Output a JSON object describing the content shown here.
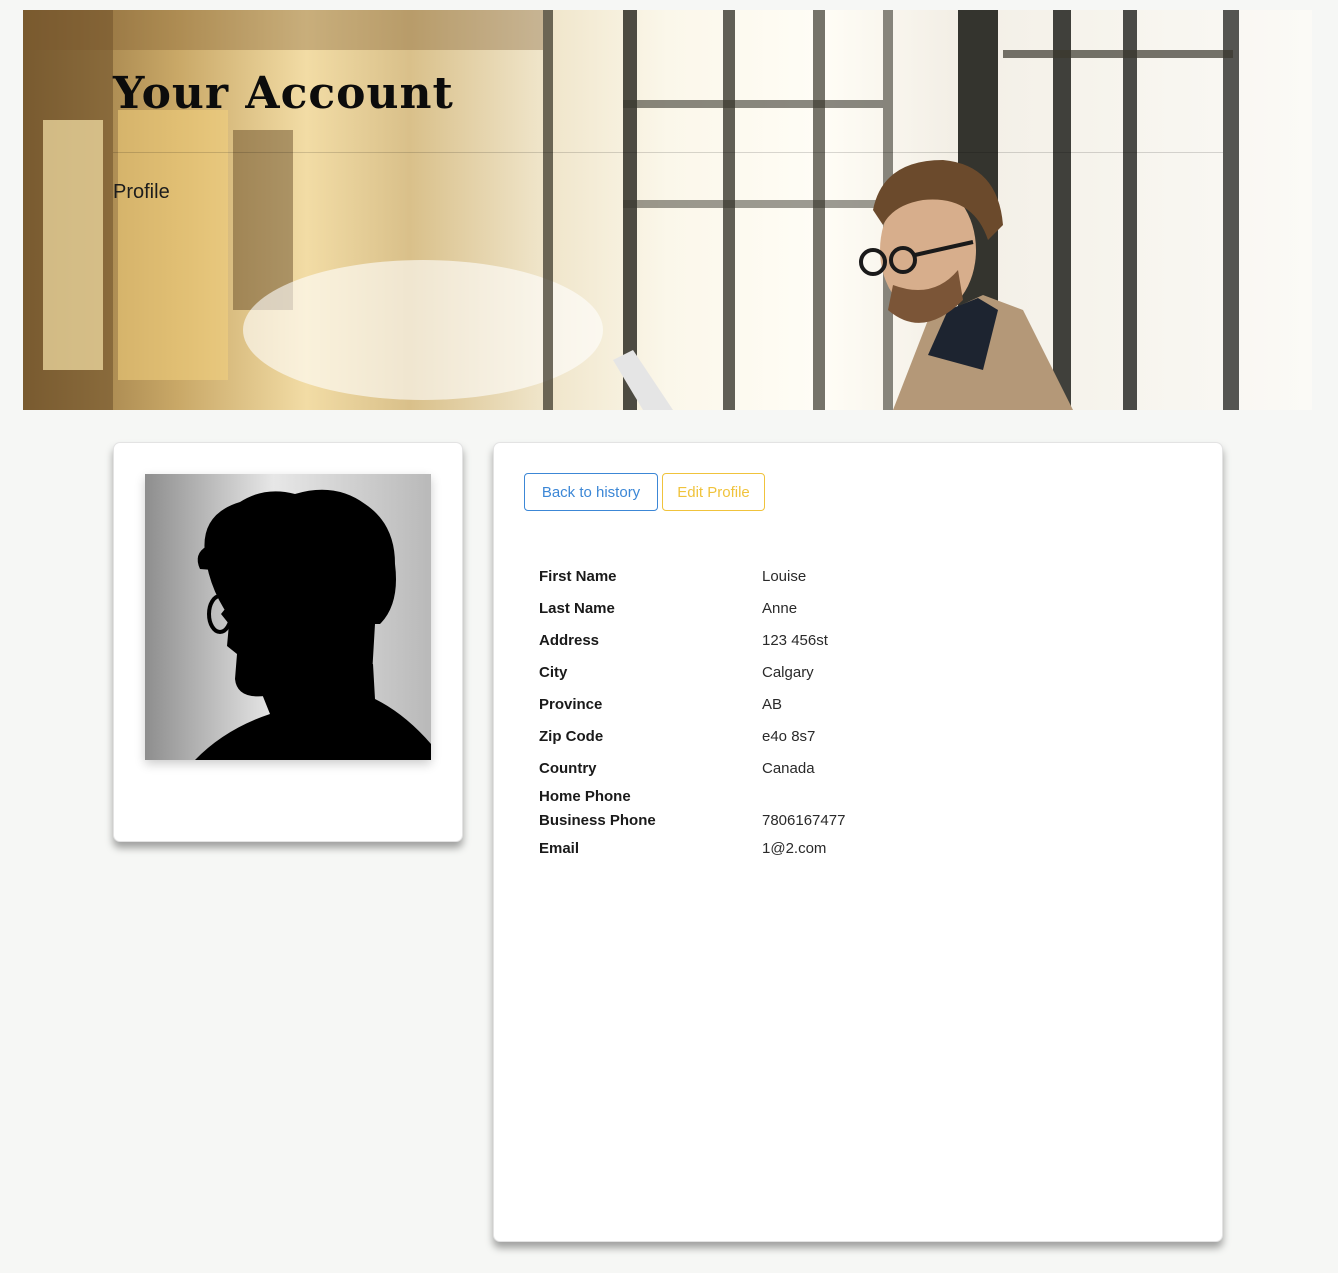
{
  "header": {
    "title": "Your Account",
    "subtitle": "Profile",
    "banner_image": "man-with-glasses-by-window-photo"
  },
  "avatar": {
    "image": "silhouette-profile-photo"
  },
  "actions": {
    "back_label": "Back to history",
    "edit_label": "Edit Profile"
  },
  "profile": {
    "fields": [
      {
        "label": "First Name",
        "value": "Louise"
      },
      {
        "label": "Last Name",
        "value": "Anne"
      },
      {
        "label": "Address",
        "value": "123 456st"
      },
      {
        "label": "City",
        "value": "Calgary"
      },
      {
        "label": "Province",
        "value": "AB"
      },
      {
        "label": "Zip Code",
        "value": "e4o 8s7"
      },
      {
        "label": "Country",
        "value": "Canada"
      },
      {
        "label": "Home Phone",
        "value": ""
      },
      {
        "label": "Business Phone",
        "value": "7806167477"
      },
      {
        "label": "Email",
        "value": "1@2.com"
      }
    ]
  },
  "colors": {
    "primary_outline": "#3c87d6",
    "warning_outline": "#f0c33c",
    "page_background": "#f6f7f5"
  }
}
